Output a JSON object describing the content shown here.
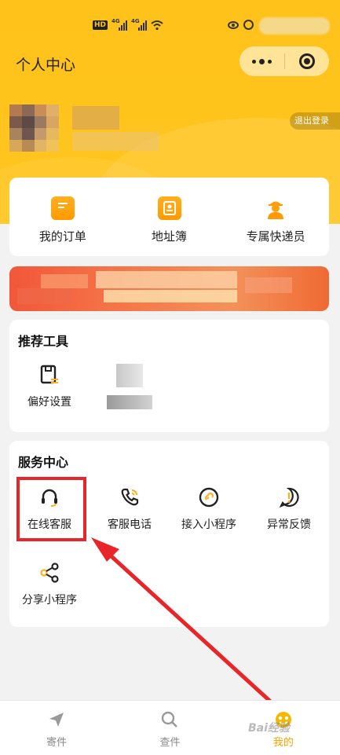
{
  "header": {
    "title": "个人中心",
    "logout_label": "退出登录",
    "statusbar": {
      "hd": "HD",
      "network_1": "4G",
      "network_2": "4G"
    }
  },
  "quick": [
    {
      "label": "我的订单",
      "icon": "order-icon"
    },
    {
      "label": "地址簿",
      "icon": "address-book-icon"
    },
    {
      "label": "专属快递员",
      "icon": "courier-icon"
    }
  ],
  "tools": {
    "title": "推荐工具",
    "items": [
      {
        "label": "偏好设置",
        "icon": "preference-icon"
      }
    ]
  },
  "service": {
    "title": "服务中心",
    "items": [
      {
        "label": "在线客服",
        "icon": "headset-icon"
      },
      {
        "label": "客服电话",
        "icon": "phone-icon"
      },
      {
        "label": "接入小程序",
        "icon": "link-icon"
      },
      {
        "label": "异常反馈",
        "icon": "alert-icon"
      },
      {
        "label": "分享小程序",
        "icon": "share-icon"
      }
    ]
  },
  "tabbar": [
    {
      "label": "寄件",
      "icon": "send-icon",
      "active": false
    },
    {
      "label": "查件",
      "icon": "search-icon",
      "active": false
    },
    {
      "label": "我的",
      "icon": "mine-icon",
      "active": true
    }
  ],
  "watermark": "Bai经验",
  "colors": {
    "brand": "#ffc21a",
    "accent": "#ff9a00",
    "highlight": "#e8262a"
  }
}
